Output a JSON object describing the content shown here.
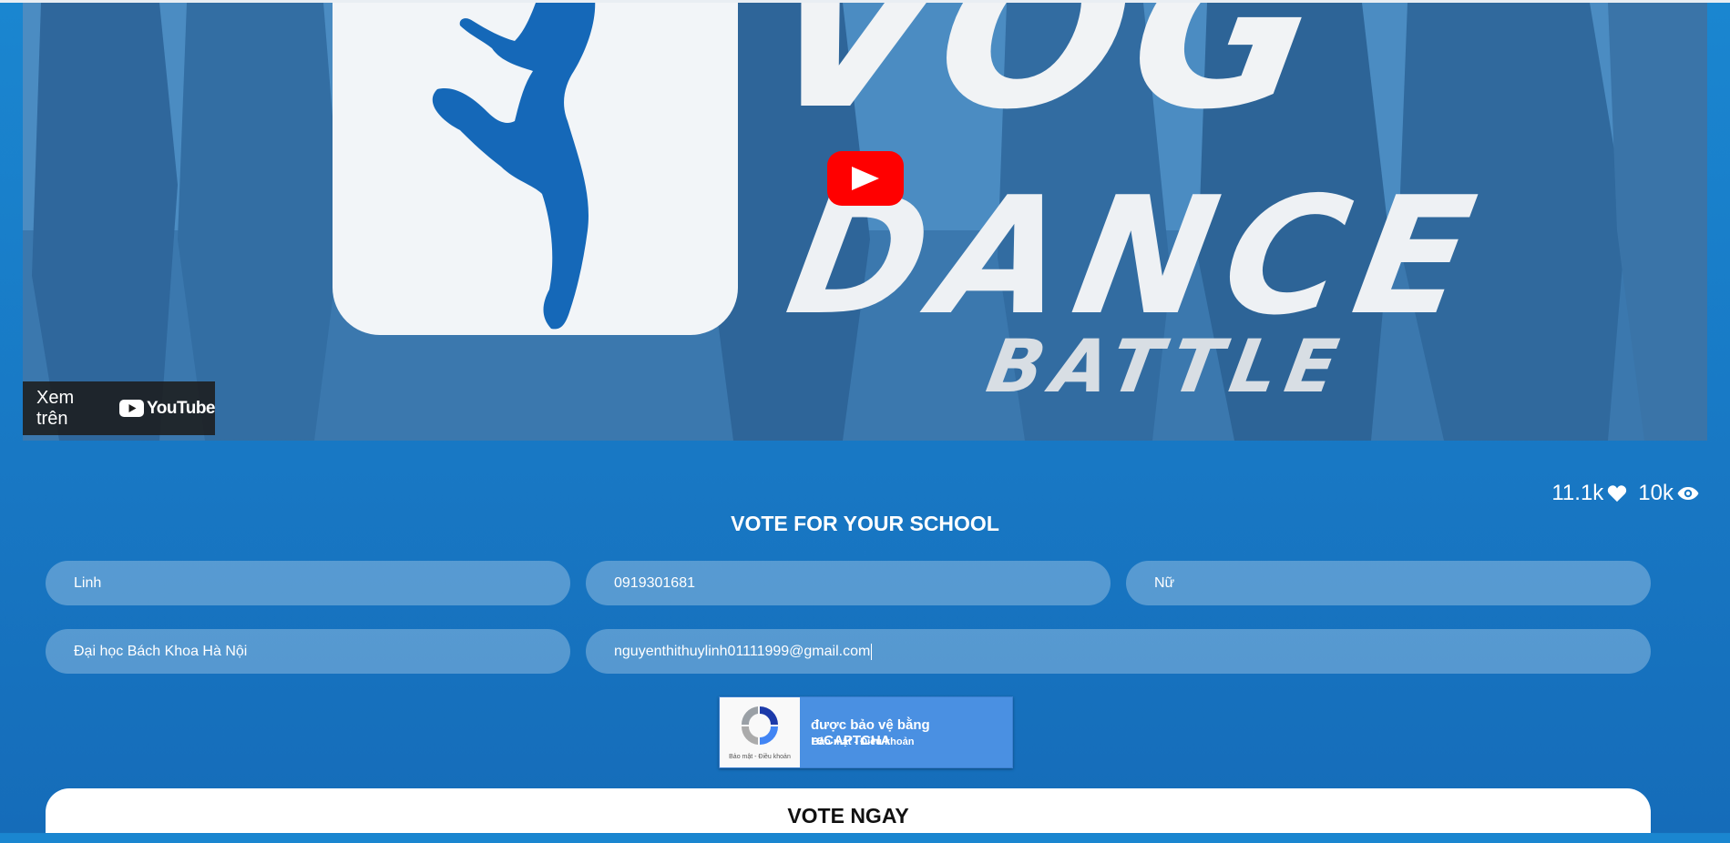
{
  "video": {
    "title_line1": "VOG",
    "title_line2": "DANCE",
    "title_line3": "BATTLE",
    "watch_on_label": "Xem trên",
    "youtube_wordmark": "YouTube",
    "play_icon": "play-icon"
  },
  "stats": {
    "likes": "11.1k",
    "likes_icon": "heart-icon",
    "views": "10k",
    "views_icon": "eye-icon"
  },
  "form": {
    "title": "VOTE FOR YOUR SCHOOL",
    "name_value": "Linh",
    "phone_value": "0919301681",
    "gender_value": "Nữ",
    "school_value": "Đại học Bách Khoa Hà Nội",
    "email_value": "nguyenthithuylinh01111999@gmail.com",
    "submit_label": "VOTE NGAY"
  },
  "recaptcha": {
    "protected_text": "được bảo vệ bằng reCAPTCHA",
    "privacy_terms": "Bảo mật - Điều khoản",
    "logo_links": "Bảo mật - Điều khoản"
  },
  "colors": {
    "background": "#1878c4",
    "youtube_red": "#ff0000",
    "recaptcha_blue": "#4a90e2"
  }
}
